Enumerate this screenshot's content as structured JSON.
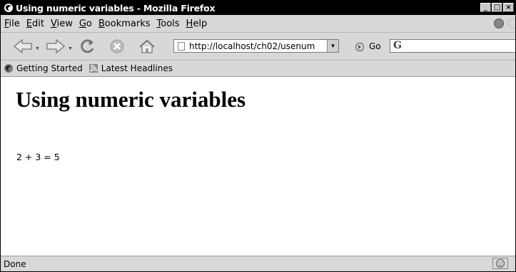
{
  "window": {
    "title": "Using numeric variables - Mozilla Firefox"
  },
  "menubar": {
    "items": [
      {
        "label": "File",
        "key": "F",
        "rest": "ile"
      },
      {
        "label": "Edit",
        "key": "E",
        "rest": "dit"
      },
      {
        "label": "View",
        "key": "V",
        "rest": "iew"
      },
      {
        "label": "Go",
        "key": "G",
        "rest": "o"
      },
      {
        "label": "Bookmarks",
        "key": "B",
        "rest": "ookmarks"
      },
      {
        "label": "Tools",
        "key": "T",
        "rest": "ools"
      },
      {
        "label": "Help",
        "key": "H",
        "rest": "elp"
      }
    ]
  },
  "navbar": {
    "url": "http://localhost/ch02/usenum",
    "go_label": "Go",
    "search_placeholder": "G"
  },
  "bookmarks": {
    "items": [
      {
        "label": "Getting Started",
        "icon": "firefox-icon"
      },
      {
        "label": "Latest Headlines",
        "icon": "rss-feed-icon"
      }
    ]
  },
  "content": {
    "heading": "Using numeric variables",
    "result": "2 + 3 = 5"
  },
  "status": {
    "text": "Done"
  }
}
